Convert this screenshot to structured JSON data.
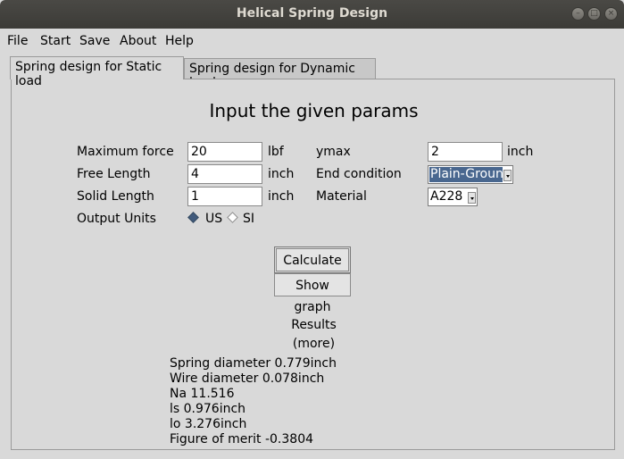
{
  "window": {
    "title": "Helical Spring Design"
  },
  "menu": [
    "File",
    "Start",
    "Save",
    "About",
    "Help"
  ],
  "tabs": [
    "Spring design for Static load",
    "Spring design for Dynamic load"
  ],
  "form": {
    "heading": "Input the given params",
    "max_force": {
      "label": "Maximum force",
      "value": "20",
      "unit": "lbf"
    },
    "free_length": {
      "label": "Free Length",
      "value": "4",
      "unit": "inch"
    },
    "solid_length": {
      "label": "Solid Length",
      "value": "1",
      "unit": "inch"
    },
    "output_units": {
      "label": "Output Units",
      "options": [
        "US",
        "SI"
      ],
      "selected": "US"
    },
    "ymax": {
      "label": "ymax",
      "value": "2",
      "unit": "inch"
    },
    "end_condition": {
      "label": "End condition",
      "value": "Plain-Ground"
    },
    "material": {
      "label": "Material",
      "value": "A228"
    }
  },
  "buttons": {
    "calculate": "Calculate",
    "show_graph": "Show graph"
  },
  "results": {
    "title": "Results",
    "more": "(more)",
    "lines": [
      "Spring diameter 0.779inch",
      "Wire diameter 0.078inch",
      "Na 11.516",
      "ls 0.976inch",
      "lo 3.276inch",
      "Figure of merit -0.3804"
    ]
  }
}
